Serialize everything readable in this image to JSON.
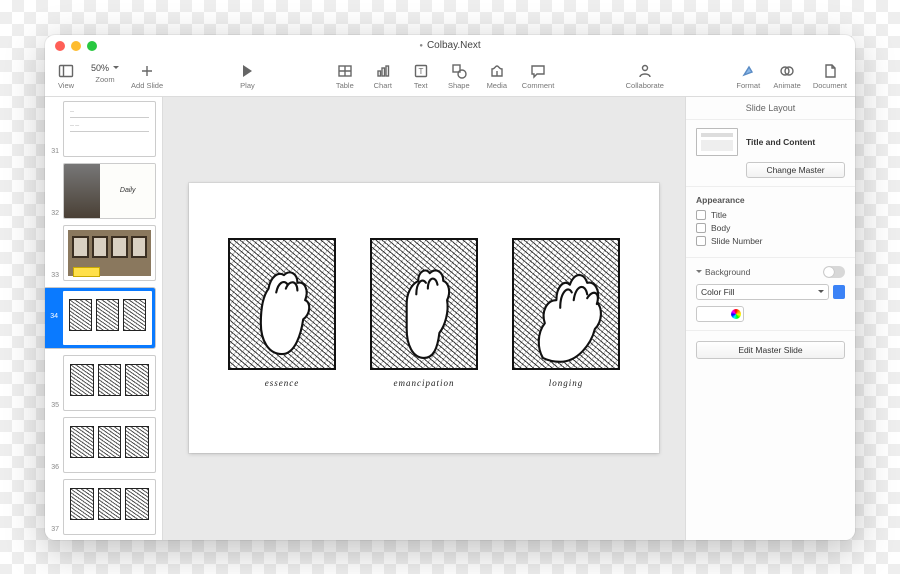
{
  "window": {
    "title": "Colbay.Next"
  },
  "toolbar": {
    "view": "View",
    "zoom_value": "50%",
    "zoom": "Zoom",
    "add_slide": "Add Slide",
    "play": "Play",
    "table": "Table",
    "chart": "Chart",
    "text": "Text",
    "shape": "Shape",
    "media": "Media",
    "comment": "Comment",
    "collaborate": "Collaborate",
    "format": "Format",
    "animate": "Animate",
    "document": "Document"
  },
  "slides": {
    "n31": "31",
    "n32": "32",
    "n33": "33",
    "n34": "34",
    "n35": "35",
    "n36": "36",
    "n37": "37",
    "s32_text": "Daily"
  },
  "canvas": {
    "captions": {
      "a": "essence",
      "b": "emancipation",
      "c": "longing"
    }
  },
  "inspector": {
    "panel_title": "Slide Layout",
    "layout_name": "Title and Content",
    "change_master": "Change Master",
    "appearance": "Appearance",
    "chk_title": "Title",
    "chk_body": "Body",
    "chk_slide_number": "Slide Number",
    "background": "Background",
    "fill_mode": "Color Fill",
    "edit_master": "Edit Master Slide"
  }
}
